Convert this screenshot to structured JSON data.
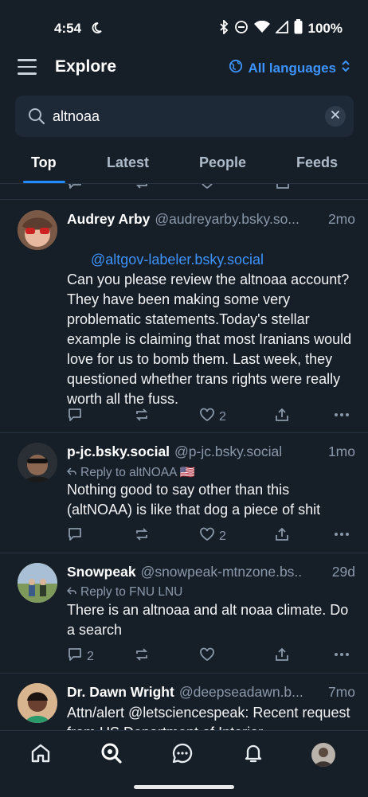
{
  "status": {
    "time": "4:54",
    "battery": "100%"
  },
  "header": {
    "title": "Explore",
    "language": "All languages"
  },
  "search": {
    "value": "altnoaa",
    "placeholder": "Search"
  },
  "tabs": [
    "Top",
    "Latest",
    "People",
    "Feeds"
  ],
  "posts": [
    {
      "name": "Audrey Arby",
      "handle": "@audreyarby.bsky.so...",
      "time": "2mo",
      "mention": "@altgov-labeler.bsky.social",
      "text": "Can you please review the altnoaa account? They have been making some very problematic statements.Today's stellar example is claiming that most Iranians would love for us to bomb them. Last week, they questioned whether trans rights were really worth all the fuss.",
      "likes": "2"
    },
    {
      "name": "p-jc.bsky.social",
      "handle": "@p-jc.bsky.social",
      "time": "1mo",
      "reply_to": "Reply to altNOAA 🇺🇸",
      "text": "Nothing good to say other than this (altNOAA) is like that dog a piece of shit",
      "likes": "2"
    },
    {
      "name": "Snowpeak",
      "handle": "@snowpeak-mtnzone.bs..",
      "time": "29d",
      "reply_to": "Reply to FNU LNU",
      "text": "There is an altnoaa and alt noaa climate. Do a search",
      "replies": "2"
    },
    {
      "name": "Dr. Dawn Wright",
      "handle": "@deepseadawn.b...",
      "time": "7mo",
      "text": "Attn/alert @letsciencespeak: Recent request from US Department of Interior"
    }
  ],
  "colors": {
    "background": "#161e27",
    "accent": "#208bfe",
    "muted": "#8a99aa"
  }
}
